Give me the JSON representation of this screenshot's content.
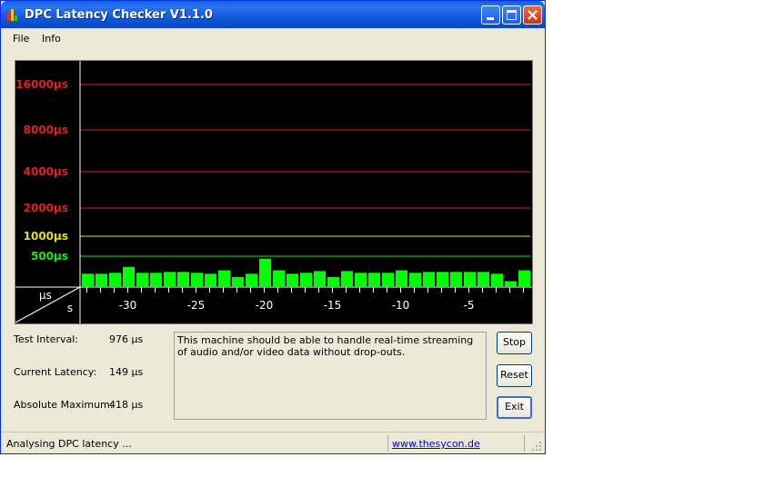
{
  "window": {
    "title": "DPC Latency Checker V1.1.0"
  },
  "menu": [
    {
      "label": "File"
    },
    {
      "label": "Info"
    }
  ],
  "chart_data": {
    "type": "bar",
    "y_scale": "log",
    "y_unit_label": "µs",
    "x_unit_label": "s",
    "y_ticks": [
      {
        "label": "16000µs",
        "value": 16000,
        "color": "#e02020"
      },
      {
        "label": "8000µs",
        "value": 8000,
        "color": "#e02020"
      },
      {
        "label": "4000µs",
        "value": 4000,
        "color": "#e02020"
      },
      {
        "label": "2000µs",
        "value": 2000,
        "color": "#e02020"
      },
      {
        "label": "1000µs",
        "value": 1000,
        "color": "#e0e020"
      },
      {
        "label": "500µs",
        "value": 500,
        "color": "#20e020"
      }
    ],
    "x_ticks": [
      {
        "label": "-30",
        "value": -30
      },
      {
        "label": "-25",
        "value": -25
      },
      {
        "label": "-20",
        "value": -20
      },
      {
        "label": "-15",
        "value": -15
      },
      {
        "label": "-10",
        "value": -10
      },
      {
        "label": "-5",
        "value": -5
      }
    ],
    "x_range": [
      -33,
      0
    ],
    "bar_color": "#00ff00",
    "x": [
      -33,
      -32,
      -31,
      -30,
      -29,
      -28,
      -27,
      -26,
      -25,
      -24,
      -23,
      -22,
      -21,
      -20,
      -19,
      -18,
      -17,
      -16,
      -15,
      -14,
      -13,
      -12,
      -11,
      -10,
      -9,
      -8,
      -7,
      -6,
      -5,
      -4,
      -3,
      -2,
      -1
    ],
    "values": [
      150,
      150,
      160,
      240,
      160,
      160,
      170,
      170,
      160,
      150,
      190,
      120,
      150,
      420,
      190,
      150,
      160,
      180,
      120,
      180,
      160,
      160,
      160,
      190,
      160,
      170,
      170,
      170,
      170,
      170,
      150,
      90,
      190
    ]
  },
  "stats": {
    "test_interval_label": "Test Interval:",
    "test_interval_value": "976 µs",
    "current_latency_label": "Current Latency:",
    "current_latency_value": "149 µs",
    "absolute_maximum_label": "Absolute Maximum:",
    "absolute_maximum_value": "418 µs"
  },
  "message": "This machine should be able to handle real-time streaming of audio and/or video data without drop-outs.",
  "buttons": {
    "stop": "Stop",
    "reset": "Reset",
    "exit": "Exit"
  },
  "status": {
    "text": "Analysing DPC latency ...",
    "link": "www.thesycon.de"
  }
}
